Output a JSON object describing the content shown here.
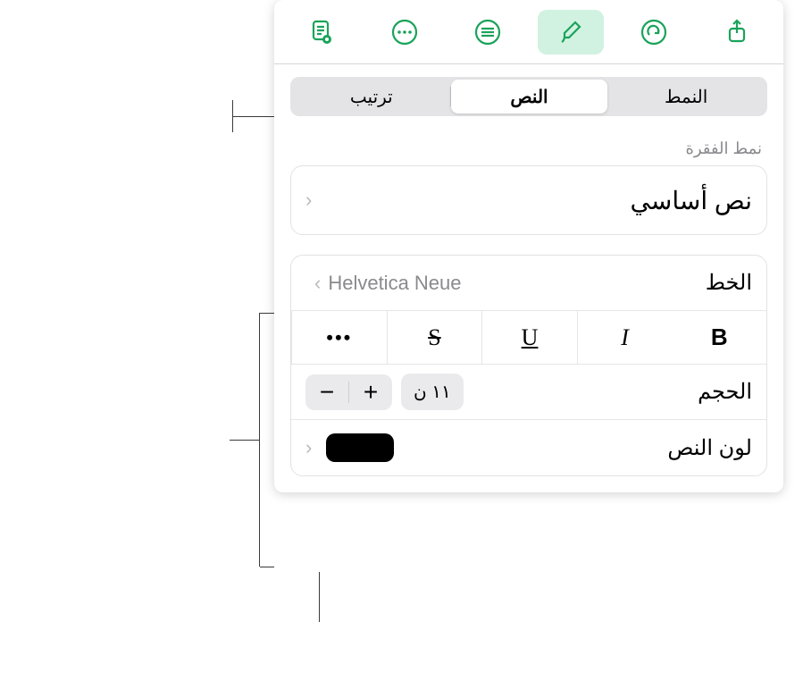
{
  "tabs": {
    "style": "النمط",
    "text": "النص",
    "arrange": "ترتيب"
  },
  "section": {
    "paragraph_style_header": "نمط الفقرة"
  },
  "paragraph": {
    "name": "نص أساسي"
  },
  "font": {
    "label": "الخط",
    "value": "Helvetica Neue"
  },
  "style_row": {
    "bold": "B",
    "italic": "I",
    "underline": "U",
    "strike": "S",
    "more": "•••"
  },
  "size": {
    "label": "الحجم",
    "value": "١١ ن",
    "minus": "−",
    "plus": "+"
  },
  "text_color": {
    "label": "لون النص",
    "color": "#000000"
  }
}
